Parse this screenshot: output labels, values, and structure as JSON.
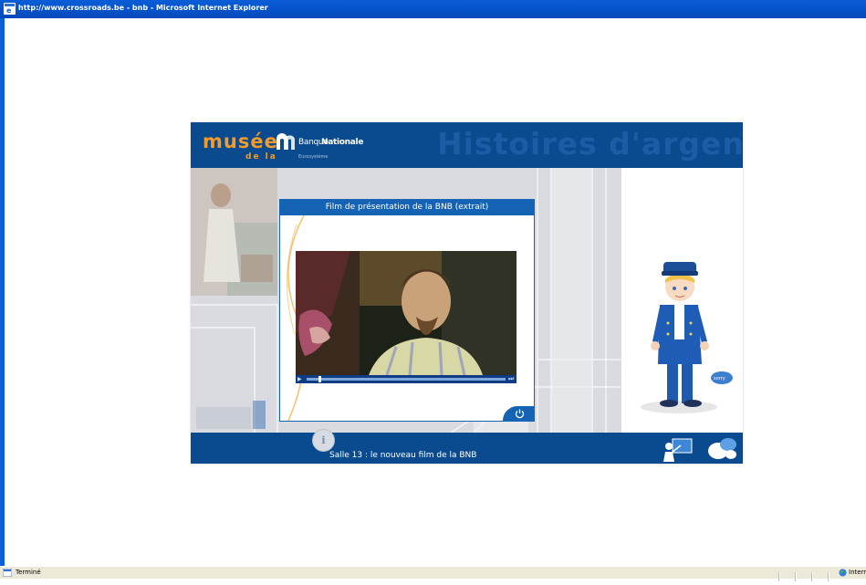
{
  "window": {
    "title": "http://www.crossroads.be - bnb - Microsoft Internet Explorer"
  },
  "status": {
    "left_text": "Terminé",
    "zone_text": "Intern"
  },
  "app": {
    "logo": {
      "musee": "musée",
      "de_la": "de la",
      "bank_part1": "Banque",
      "bank_part2": "Nationale",
      "eurosystem": "Eurosystème"
    },
    "header_watermark": "Histoires d'argent",
    "dialog": {
      "title": "Film de présentation de la BNB (extrait)",
      "video_progress": 0.06
    },
    "room_label": "Salle 13 : le nouveau film de la BNB",
    "info_button": "i",
    "speech_bubble": "sorry"
  },
  "colors": {
    "titlebar": "#0552c8",
    "app_blue": "#0a4a8e",
    "dialog_blue": "#1463b4",
    "orange": "#f39b2a"
  }
}
